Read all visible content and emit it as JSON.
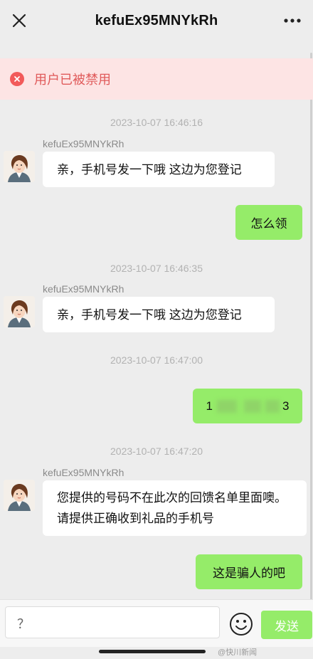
{
  "header": {
    "title": "kefuEx95MNYkRh",
    "close_icon": "close-icon",
    "more_icon": "more-horizontal-icon"
  },
  "banner": {
    "text": "用户已被禁用",
    "icon": "error-circle-icon",
    "bg_color": "#fde4e4",
    "text_color": "#e05a5a"
  },
  "messages": [
    {
      "timestamp": "2023-10-07 16:46:16",
      "sender": "kefuEx95MNYkRh",
      "text": "亲，手机号发一下哦 这边为您登记"
    },
    {
      "from": "me",
      "text": "怎么领"
    },
    {
      "timestamp": "2023-10-07 16:46:35",
      "sender": "kefuEx95MNYkRh",
      "text": "亲，手机号发一下哦 这边为您登记"
    },
    {
      "timestamp": "2023-10-07 16:47:00",
      "from": "me",
      "text_start": "1",
      "text_end": "3"
    },
    {
      "timestamp": "2023-10-07 16:47:20",
      "sender": "kefuEx95MNYkRh",
      "text": "您提供的号码不在此次的回馈名单里面噢。请提供正确收到礼品的手机号"
    },
    {
      "from": "me",
      "text": "这是骗人的吧"
    }
  ],
  "composer": {
    "input_value": "？",
    "send_label": "发送",
    "emoji_icon": "emoji-smile-icon"
  },
  "watermark": "@快川新闻",
  "colors": {
    "bubble_me": "#95ec69",
    "bubble_other": "#ffffff",
    "background": "#ededed"
  }
}
